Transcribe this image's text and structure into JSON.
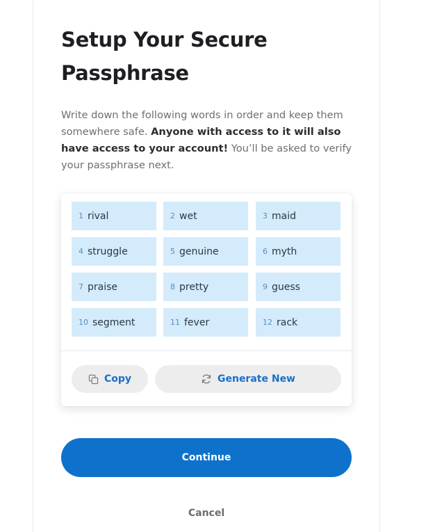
{
  "title": "Setup Your Secure Passphrase",
  "description": {
    "part1": "Write down the following words in order and keep them somewhere safe. ",
    "bold": "Anyone with access to it will also have access to your account!",
    "part2": " You’ll be asked to verify your passphrase next."
  },
  "words": [
    {
      "n": "1",
      "w": "rival"
    },
    {
      "n": "2",
      "w": "wet"
    },
    {
      "n": "3",
      "w": "maid"
    },
    {
      "n": "4",
      "w": "struggle"
    },
    {
      "n": "5",
      "w": "genuine"
    },
    {
      "n": "6",
      "w": "myth"
    },
    {
      "n": "7",
      "w": "praise"
    },
    {
      "n": "8",
      "w": "pretty"
    },
    {
      "n": "9",
      "w": "guess"
    },
    {
      "n": "10",
      "w": "segment"
    },
    {
      "n": "11",
      "w": "fever"
    },
    {
      "n": "12",
      "w": "rack"
    }
  ],
  "actions": {
    "copy_label": "Copy",
    "generate_label": "Generate New"
  },
  "continue_label": "Continue",
  "cancel_label": "Cancel",
  "icons": {
    "copy": "copy-icon",
    "refresh": "refresh-icon"
  },
  "colors": {
    "accent": "#0e72cc",
    "word_bg": "#d4ebfc",
    "link": "#1a6fc7"
  }
}
